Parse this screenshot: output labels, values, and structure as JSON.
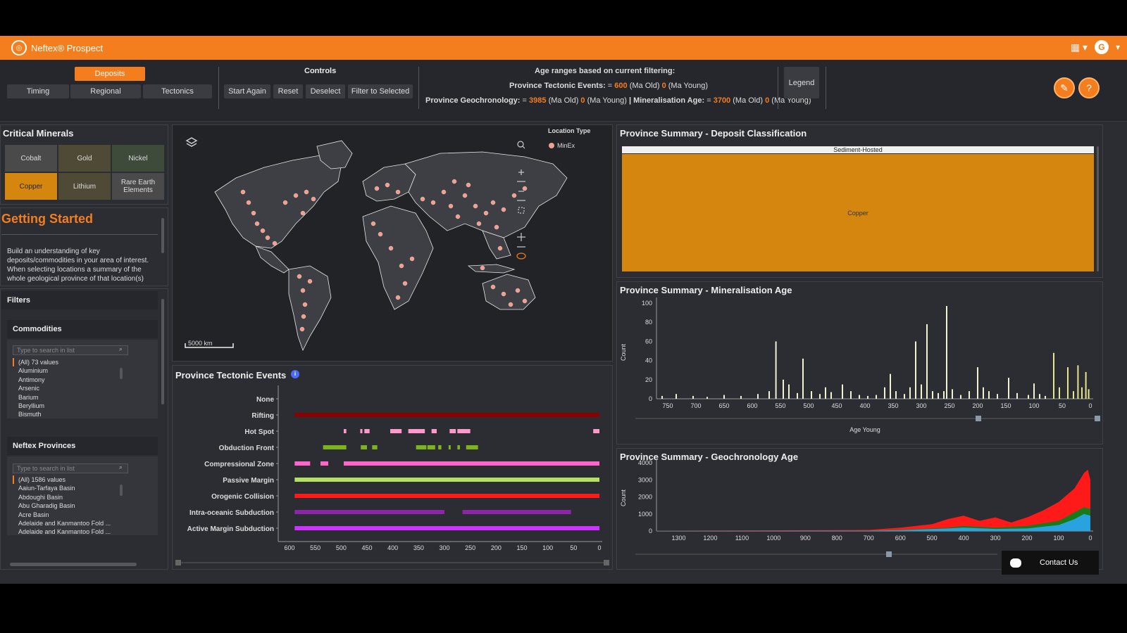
{
  "app": {
    "title": "Neftex® Prospect",
    "user_initial": "G"
  },
  "tabs": {
    "deposits": "Deposits",
    "timing": "Timing",
    "regional": "Regional",
    "tectonics": "Tectonics"
  },
  "controls": {
    "title": "Controls",
    "start_again": "Start Again",
    "reset": "Reset",
    "deselect": "Deselect",
    "filter_selected": "Filter to Selected"
  },
  "age_ranges": {
    "title": "Age ranges based on current filtering:",
    "tectonic_label": "Province Tectonic Events:",
    "tectonic_old": "600",
    "tectonic_young": "0",
    "geochron_label": "Province Geochronology:",
    "geochron_old": "3985",
    "geochron_young": "0",
    "mineral_label": "Mineralisation Age:",
    "mineral_old": "3700",
    "mineral_young": "0",
    "ma_old": "(Ma Old)",
    "ma_young": "(Ma Young)",
    "eq": "=",
    "sep": "|"
  },
  "legend_button": "Legend",
  "critical_minerals": {
    "title": "Critical Minerals",
    "items": [
      "Cobalt",
      "Gold",
      "Nickel",
      "Copper",
      "Lithium",
      "Rare Earth Elements"
    ],
    "selected": "Copper"
  },
  "getting_started": {
    "title": "Getting Started",
    "text": "Build an understanding of key deposits/commodities in your area of interest. When selecting locations a summary of the whole geological province of that location(s)"
  },
  "filters": {
    "title": "Filters",
    "commodities": {
      "title": "Commodities",
      "placeholder": "Type to search in list",
      "items": [
        "(All) 73 values",
        "Aluminium",
        "Antimony",
        "Arsenic",
        "Barium",
        "Beryllium",
        "Bismuth"
      ]
    },
    "provinces": {
      "title": "Neftex Provinces",
      "placeholder": "Type to search in list",
      "items": [
        "(All) 1586 values",
        "Aaiun-Tarfaya Basin",
        "Abdoughi Basin",
        "Abu Gharadig Basin",
        "Acre Basin",
        "Adelaide and Kanmantoo Fold ...",
        "Adelaide and Kanmantoo Fold ..."
      ]
    }
  },
  "map": {
    "location_type_title": "Location Type",
    "legend_item": "MinEx",
    "scale": "5000 km"
  },
  "tectonic_events": {
    "title": "Province Tectonic Events",
    "chart_data": {
      "type": "gantt",
      "xlim": [
        600,
        0
      ],
      "xticks": [
        600,
        550,
        500,
        450,
        400,
        350,
        300,
        250,
        200,
        150,
        100,
        50,
        0
      ],
      "rows": [
        {
          "name": "None",
          "color": "#f47d1e",
          "segments": []
        },
        {
          "name": "Rifting",
          "color": "#8b0000",
          "segments": [
            [
              590,
              0
            ]
          ]
        },
        {
          "name": "Hot Spot",
          "color": "#ff99cc",
          "segments": [
            [
              495,
              490
            ],
            [
              463,
              460
            ],
            [
              455,
              445
            ],
            [
              405,
              383
            ],
            [
              370,
              338
            ],
            [
              325,
              315
            ],
            [
              290,
              278
            ],
            [
              275,
              250
            ],
            [
              12,
              0
            ]
          ]
        },
        {
          "name": "Obduction Front",
          "color": "#7cb518",
          "segments": [
            [
              535,
              490
            ],
            [
              462,
              450
            ],
            [
              440,
              430
            ],
            [
              355,
              335
            ],
            [
              333,
              318
            ],
            [
              312,
              306
            ],
            [
              292,
              288
            ],
            [
              275,
              270
            ],
            [
              258,
              235
            ]
          ]
        },
        {
          "name": "Compressional Zone",
          "color": "#ff66cc",
          "segments": [
            [
              590,
              560
            ],
            [
              540,
              525
            ],
            [
              495,
              0
            ]
          ]
        },
        {
          "name": "Passive Margin",
          "color": "#b5e061",
          "segments": [
            [
              590,
              0
            ]
          ]
        },
        {
          "name": "Orogenic Collision",
          "color": "#ff1a1a",
          "segments": [
            [
              590,
              0
            ]
          ]
        },
        {
          "name": "Intra-oceanic Subduction",
          "color": "#8e24aa",
          "segments": [
            [
              590,
              300
            ],
            [
              265,
              55
            ]
          ]
        },
        {
          "name": "Active Margin Subduction",
          "color": "#cc33ff",
          "segments": [
            [
              590,
              0
            ]
          ]
        }
      ]
    }
  },
  "deposit_classification": {
    "title": "Province Summary - Deposit Classification",
    "chart_data": {
      "type": "treemap",
      "items": [
        {
          "group": "Sediment-Hosted",
          "label": "Copper",
          "color": "#d4860f"
        }
      ]
    }
  },
  "mineralisation_age": {
    "title": "Province Summary - Mineralisation Age",
    "chart_data": {
      "type": "bar",
      "ylabel": "Count",
      "xlabel": "Age Young",
      "xlim": [
        770,
        0
      ],
      "ylim": [
        0,
        100
      ],
      "xticks": [
        750,
        700,
        650,
        600,
        550,
        500,
        450,
        400,
        350,
        300,
        250,
        200,
        150,
        100,
        50,
        0
      ],
      "yticks": [
        0,
        20,
        40,
        60,
        80,
        100
      ],
      "bars": [
        [
          760,
          3
        ],
        [
          735,
          5
        ],
        [
          705,
          3
        ],
        [
          680,
          2
        ],
        [
          650,
          4
        ],
        [
          620,
          3
        ],
        [
          590,
          5
        ],
        [
          570,
          8
        ],
        [
          558,
          60
        ],
        [
          545,
          20
        ],
        [
          535,
          15
        ],
        [
          520,
          6
        ],
        [
          510,
          42
        ],
        [
          495,
          8
        ],
        [
          480,
          5
        ],
        [
          470,
          12
        ],
        [
          460,
          7
        ],
        [
          440,
          15
        ],
        [
          425,
          8
        ],
        [
          410,
          4
        ],
        [
          395,
          3
        ],
        [
          380,
          4
        ],
        [
          365,
          12
        ],
        [
          355,
          26
        ],
        [
          345,
          8
        ],
        [
          330,
          5
        ],
        [
          320,
          12
        ],
        [
          310,
          60
        ],
        [
          300,
          15
        ],
        [
          290,
          78
        ],
        [
          280,
          8
        ],
        [
          270,
          6
        ],
        [
          260,
          8
        ],
        [
          255,
          97
        ],
        [
          245,
          10
        ],
        [
          230,
          4
        ],
        [
          215,
          8
        ],
        [
          200,
          33
        ],
        [
          190,
          12
        ],
        [
          180,
          8
        ],
        [
          165,
          5
        ],
        [
          145,
          22
        ],
        [
          130,
          6
        ],
        [
          110,
          4
        ],
        [
          100,
          16
        ],
        [
          90,
          5
        ],
        [
          80,
          3
        ],
        [
          65,
          48
        ],
        [
          55,
          12
        ],
        [
          40,
          33
        ],
        [
          30,
          8
        ],
        [
          22,
          35
        ],
        [
          15,
          12
        ],
        [
          8,
          28
        ],
        [
          3,
          10
        ]
      ]
    }
  },
  "geochronology_age": {
    "title": "Province Summary - Geochronology Age",
    "chart_data": {
      "type": "area",
      "ylabel": "Count",
      "xlim": [
        1370,
        0
      ],
      "ylim": [
        0,
        4000
      ],
      "xticks": [
        1300,
        1200,
        1100,
        1000,
        900,
        800,
        700,
        600,
        500,
        400,
        300,
        200,
        100,
        0
      ],
      "yticks": [
        0,
        1000,
        2000,
        3000,
        4000
      ],
      "series": [
        {
          "name": "",
          "color": "#ff1a1a",
          "points": [
            [
              1370,
              20
            ],
            [
              1000,
              40
            ],
            [
              800,
              50
            ],
            [
              700,
              60
            ],
            [
              600,
              200
            ],
            [
              550,
              300
            ],
            [
              500,
              400
            ],
            [
              450,
              700
            ],
            [
              400,
              900
            ],
            [
              350,
              600
            ],
            [
              300,
              800
            ],
            [
              250,
              500
            ],
            [
              200,
              800
            ],
            [
              150,
              1200
            ],
            [
              100,
              1700
            ],
            [
              50,
              2500
            ],
            [
              20,
              3400
            ],
            [
              8,
              3600
            ],
            [
              0,
              3000
            ]
          ]
        },
        {
          "name": "",
          "color": "#1a7a1a",
          "points": [
            [
              1370,
              10
            ],
            [
              700,
              20
            ],
            [
              600,
              80
            ],
            [
              450,
              200
            ],
            [
              400,
              300
            ],
            [
              300,
              200
            ],
            [
              200,
              300
            ],
            [
              100,
              600
            ],
            [
              50,
              1100
            ],
            [
              20,
              1400
            ],
            [
              0,
              1300
            ]
          ]
        },
        {
          "name": "",
          "color": "#29a3e0",
          "points": [
            [
              1370,
              10
            ],
            [
              700,
              15
            ],
            [
              600,
              50
            ],
            [
              450,
              150
            ],
            [
              400,
              200
            ],
            [
              300,
              120
            ],
            [
              200,
              150
            ],
            [
              100,
              350
            ],
            [
              50,
              700
            ],
            [
              20,
              1000
            ],
            [
              0,
              900
            ]
          ]
        }
      ]
    }
  },
  "contact": "Contact Us"
}
